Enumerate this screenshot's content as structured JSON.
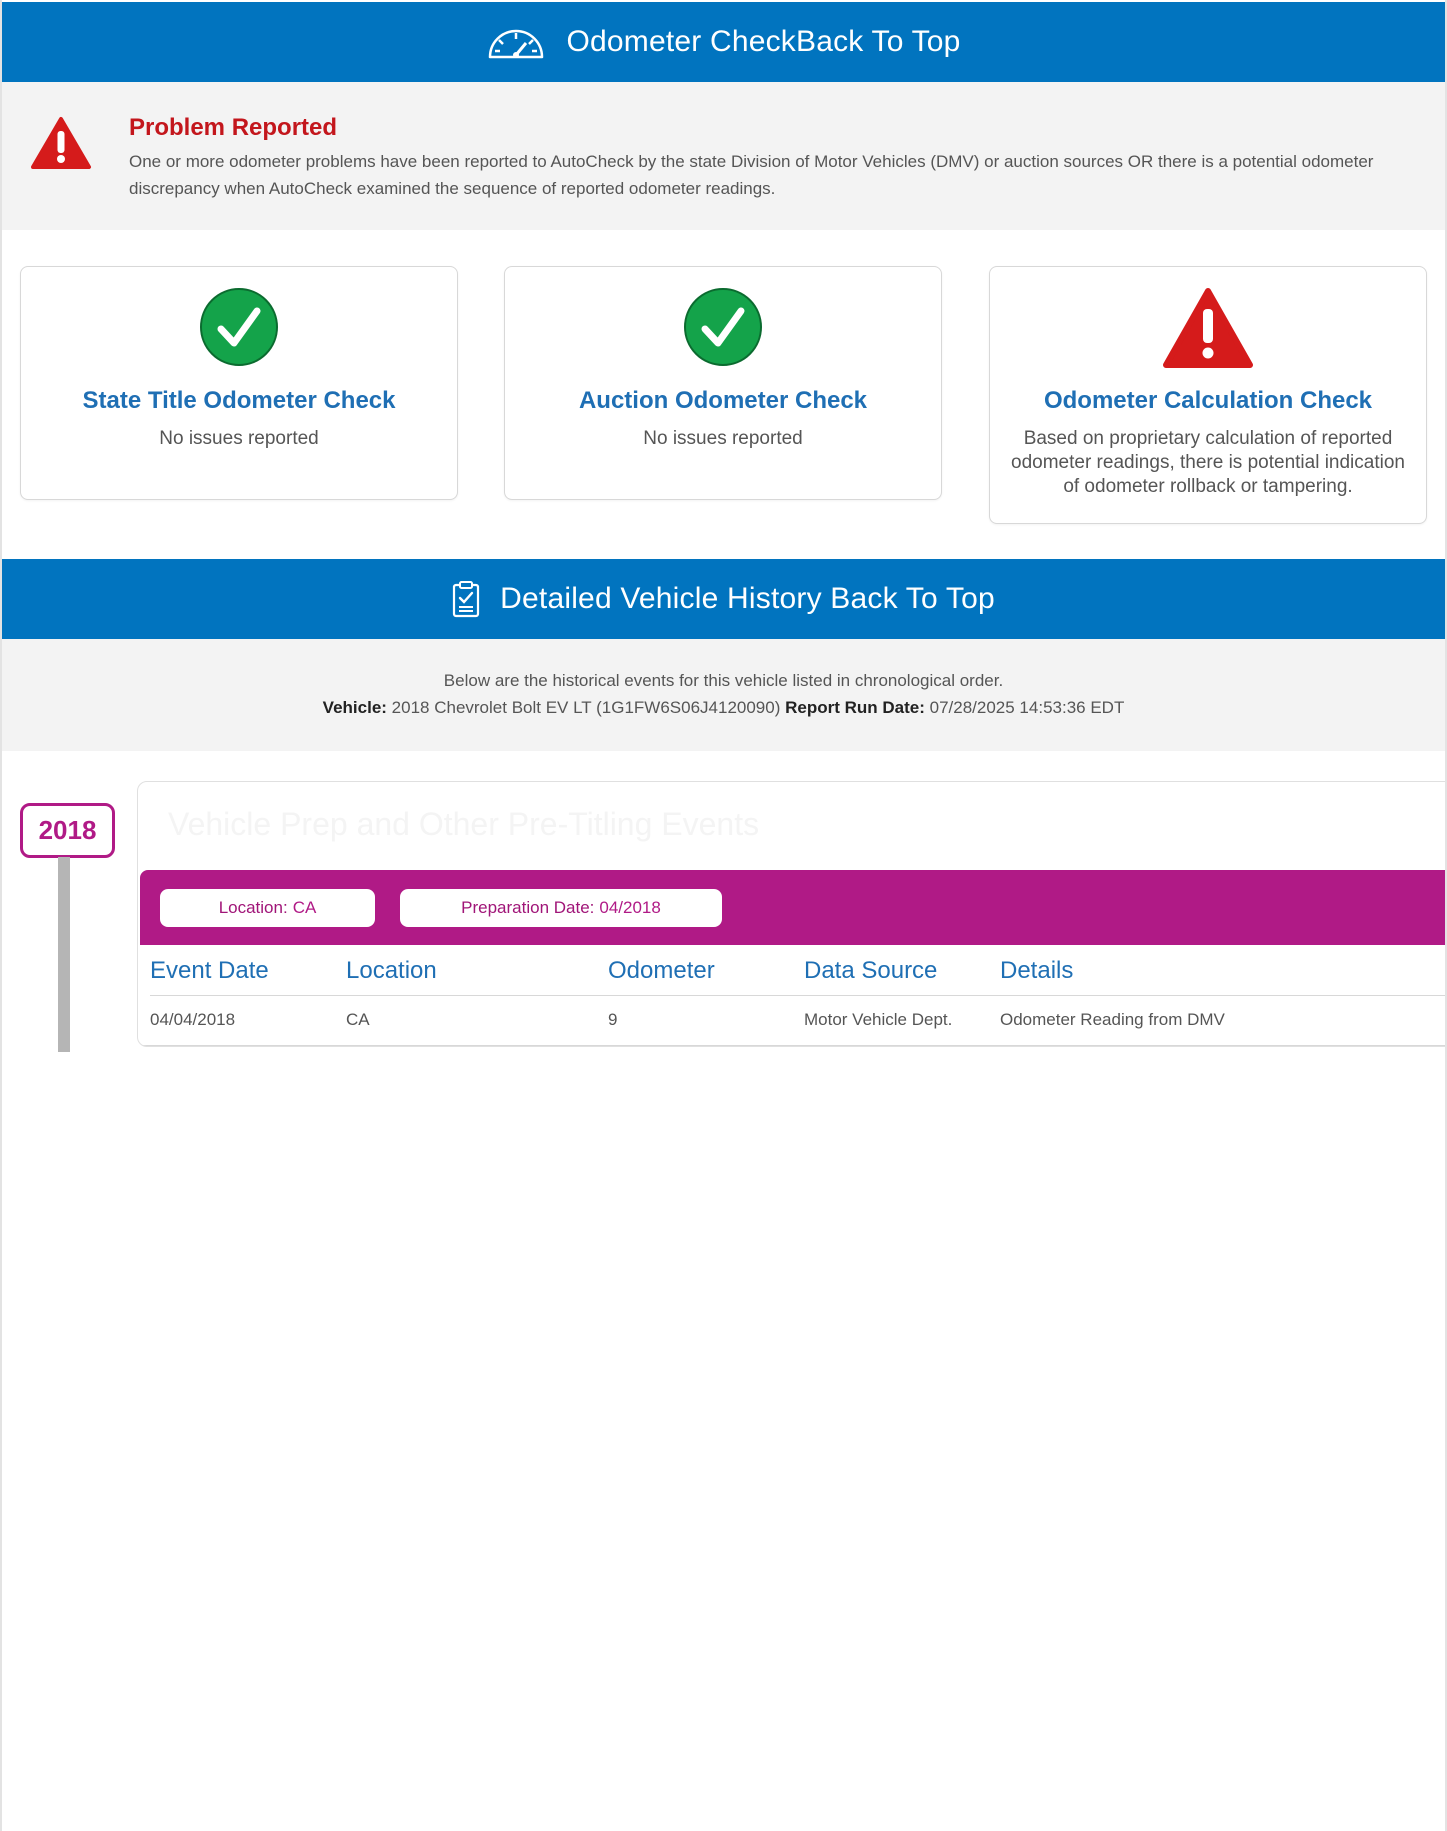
{
  "odometer_section": {
    "title": "Odometer CheckBack To Top",
    "icon": "speedometer-icon"
  },
  "problem": {
    "title": "Problem Reported",
    "text": "One or more odometer problems have been reported to AutoCheck by the state Division of Motor Vehicles (DMV) or auction sources OR there is a potential odometer discrepancy when AutoCheck examined the sequence of reported odometer readings.",
    "icon": "warning-triangle-icon",
    "color": "#c3161c"
  },
  "cards": [
    {
      "title": "State Title Odometer Check",
      "text": "No issues reported",
      "status": "ok",
      "icon": "check-circle-icon"
    },
    {
      "title": "Auction Odometer Check",
      "text": "No issues reported",
      "status": "ok",
      "icon": "check-circle-icon"
    },
    {
      "title": "Odometer Calculation Check",
      "text": "Based on proprietary calculation of reported odometer readings, there is potential indication of odometer rollback or tampering.",
      "status": "warning",
      "icon": "warning-triangle-icon"
    }
  ],
  "history_section": {
    "title": "Detailed Vehicle History Back To Top",
    "icon": "clipboard-check-icon",
    "intro": "Below are the historical events for this vehicle listed in chronological order.",
    "vehicle_label": "Vehicle:",
    "vehicle_value": "2018 Chevrolet Bolt EV LT (1G1FW6S06J4120090)",
    "run_date_label": "Report Run Date:",
    "run_date_value": "07/28/2025 14:53:36 EDT"
  },
  "timeline": {
    "year": "2018",
    "event_title": "Vehicle Prep and Other Pre-Titling Events",
    "location_label": "Location:",
    "location_value": "CA",
    "prep_label": "Preparation Date:",
    "prep_value": "04/2018",
    "table_headers": [
      "Event Date",
      "Location",
      "Odometer",
      "Data Source",
      "Details"
    ],
    "rows": [
      [
        "04/04/2018",
        "CA",
        "9",
        "Motor Vehicle Dept.",
        "Odometer Reading from DMV"
      ]
    ]
  },
  "colors": {
    "brand_blue": "#0174bf",
    "title_blue": "#1f6fb4",
    "ok_green": "#14a34a",
    "alert_red": "#d51b1b",
    "event_magenta": "#b01a86"
  }
}
